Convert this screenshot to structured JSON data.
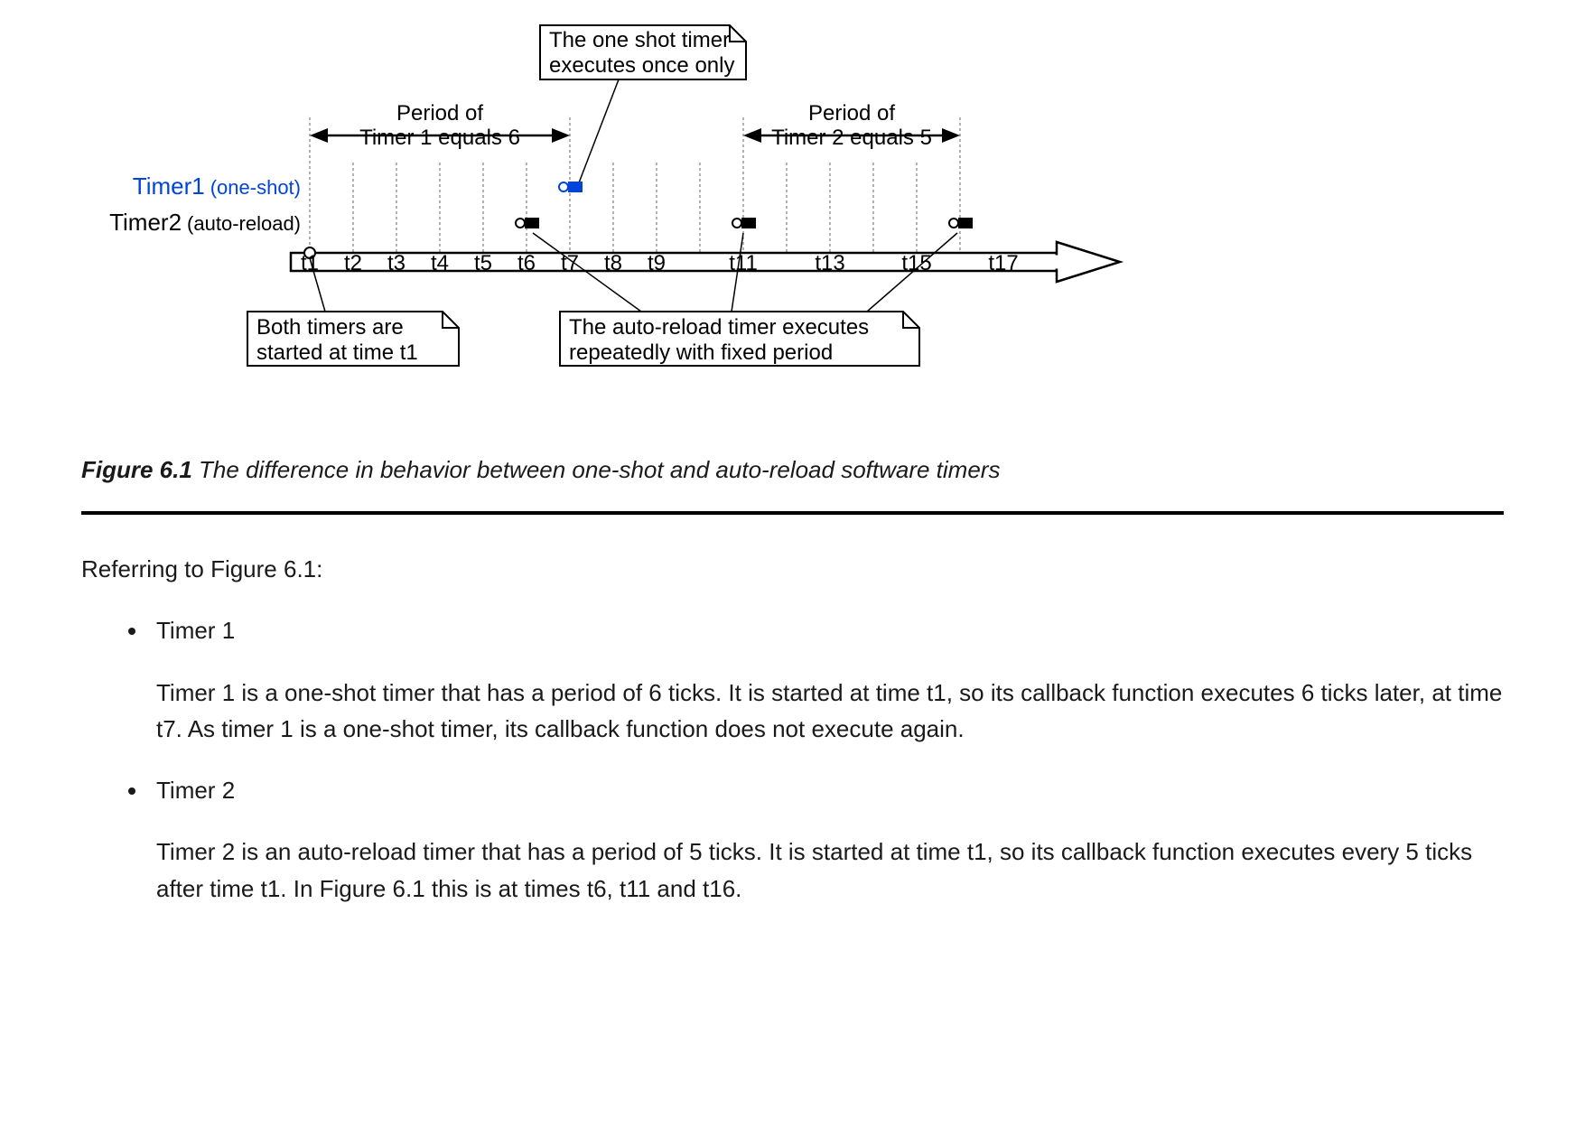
{
  "diagram": {
    "timer1_label": "Timer1",
    "timer1_type": "(one-shot)",
    "timer2_label": "Timer2",
    "timer2_type": "(auto-reload)",
    "period1_line1": "Period of",
    "period1_line2": "Timer 1 equals 6",
    "period2_line1": "Period of",
    "period2_line2": "Timer 2 equals 5",
    "note_oneshot_l1": "The one shot timer",
    "note_oneshot_l2": "executes once only",
    "note_start_l1": "Both timers are",
    "note_start_l2": "started at time t1",
    "note_auto_l1": "The auto-reload timer executes",
    "note_auto_l2": "repeatedly with fixed period",
    "ticks": {
      "t1": "t1",
      "t2": "t2",
      "t3": "t3",
      "t4": "t4",
      "t5": "t5",
      "t6": "t6",
      "t7": "t7",
      "t8": "t8",
      "t9": "t9",
      "t11": "t11",
      "t13": "t13",
      "t15": "t15",
      "t17": "t17"
    }
  },
  "caption_bold": "Figure 6.1",
  "caption_text": " The difference in behavior between one-shot and auto-reload software timers",
  "intro": "Referring to Figure 6.1:",
  "timer1_title": "Timer 1",
  "timer1_body": "Timer 1 is a one-shot timer that has a period of 6 ticks. It is started at time t1, so its callback function executes 6 ticks later, at time t7. As timer 1 is a one-shot timer, its callback function does not execute again.",
  "timer2_title": "Timer 2",
  "timer2_body": "Timer 2 is an auto-reload timer that has a period of 5 ticks. It is started at time t1, so its callback function executes every 5 ticks after time t1. In Figure 6.1 this is at times t6, t11 and t16."
}
